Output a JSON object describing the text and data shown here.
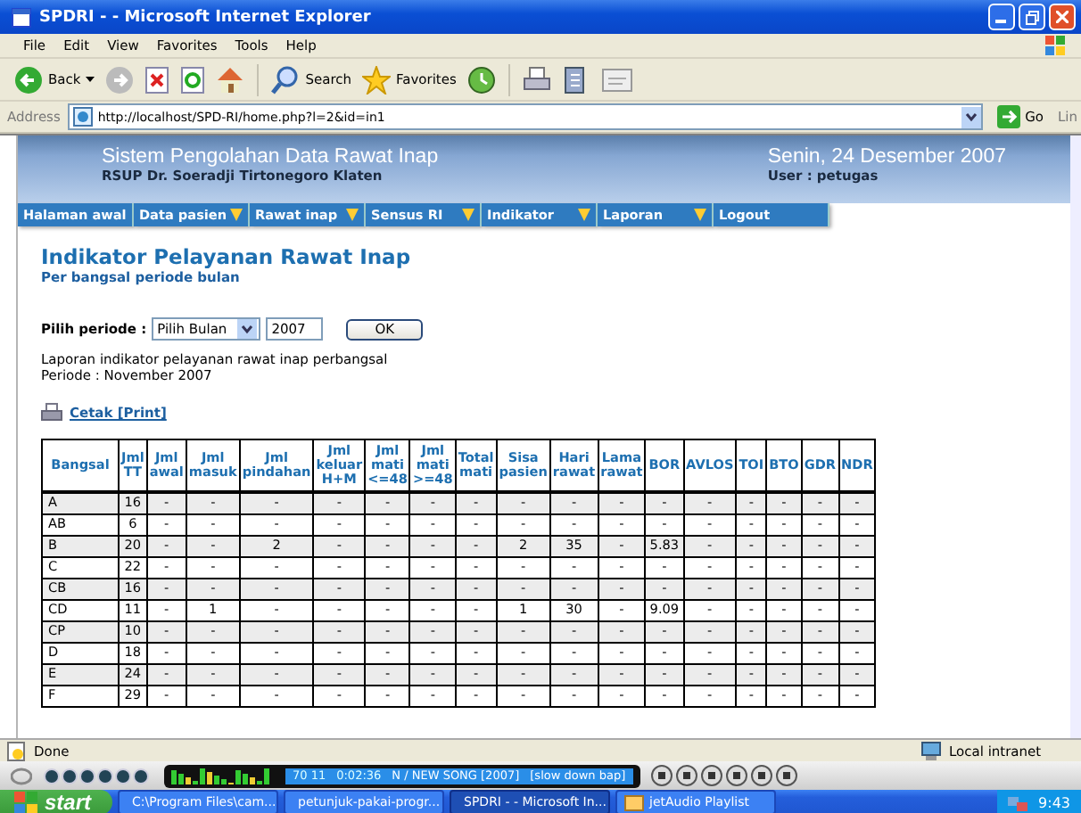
{
  "window": {
    "title": "SPDRI - - Microsoft Internet Explorer"
  },
  "menu_bar": [
    "File",
    "Edit",
    "View",
    "Favorites",
    "Tools",
    "Help"
  ],
  "toolbar": {
    "back": "Back",
    "search": "Search",
    "favorites": "Favorites"
  },
  "address_bar": {
    "label": "Address",
    "url": "http://localhost/SPD-RI/home.php?l=2&id=in1",
    "go": "Go",
    "links": "Lin"
  },
  "header": {
    "title": "Sistem Pengolahan Data Rawat Inap",
    "subtitle": "RSUP Dr. Soeradji Tirtonegoro Klaten",
    "date": "Senin, 24 Desember 2007",
    "user": "User : petugas"
  },
  "nav": [
    {
      "label": "Halaman awal",
      "has_submenu": false
    },
    {
      "label": "Data pasien",
      "has_submenu": true
    },
    {
      "label": "Rawat inap",
      "has_submenu": true
    },
    {
      "label": "Sensus RI",
      "has_submenu": true
    },
    {
      "label": "Indikator",
      "has_submenu": true
    },
    {
      "label": "Laporan",
      "has_submenu": true
    },
    {
      "label": "Logout",
      "has_submenu": false
    }
  ],
  "page": {
    "title": "Indikator Pelayanan Rawat Inap",
    "subtitle": "Per bangsal periode bulan",
    "period_label": "Pilih periode :",
    "month_select": "Pilih Bulan",
    "year": "2007",
    "ok": "OK",
    "report_line1": "Laporan indikator pelayanan rawat inap perbangsal",
    "report_line2": "Periode : November 2007",
    "print_link": "Cetak [Print]"
  },
  "table": {
    "columns": [
      "Bangsal",
      "Jml\nTT",
      "Jml\nawal",
      "Jml\nmasuk",
      "Jml\npindahan",
      "Jml\nkeluar\nH+M",
      "Jml\nmati\n<=48",
      "Jml\nmati\n>=48",
      "Total\nmati",
      "Sisa\npasien",
      "Hari\nrawat",
      "Lama\nrawat",
      "BOR",
      "AVLOS",
      "TOI",
      "BTO",
      "GDR",
      "NDR"
    ],
    "rows": [
      [
        "A",
        "16",
        "-",
        "-",
        "-",
        "-",
        "-",
        "-",
        "-",
        "-",
        "-",
        "-",
        "-",
        "-",
        "-",
        "-",
        "-",
        "-"
      ],
      [
        "AB",
        "6",
        "-",
        "-",
        "-",
        "-",
        "-",
        "-",
        "-",
        "-",
        "-",
        "-",
        "-",
        "-",
        "-",
        "-",
        "-",
        "-"
      ],
      [
        "B",
        "20",
        "-",
        "-",
        "2",
        "-",
        "-",
        "-",
        "-",
        "2",
        "35",
        "-",
        "5.83",
        "-",
        "-",
        "-",
        "-",
        "-"
      ],
      [
        "C",
        "22",
        "-",
        "-",
        "-",
        "-",
        "-",
        "-",
        "-",
        "-",
        "-",
        "-",
        "-",
        "-",
        "-",
        "-",
        "-",
        "-"
      ],
      [
        "CB",
        "16",
        "-",
        "-",
        "-",
        "-",
        "-",
        "-",
        "-",
        "-",
        "-",
        "-",
        "-",
        "-",
        "-",
        "-",
        "-",
        "-"
      ],
      [
        "CD",
        "11",
        "-",
        "1",
        "-",
        "-",
        "-",
        "-",
        "-",
        "1",
        "30",
        "-",
        "9.09",
        "-",
        "-",
        "-",
        "-",
        "-"
      ],
      [
        "CP",
        "10",
        "-",
        "-",
        "-",
        "-",
        "-",
        "-",
        "-",
        "-",
        "-",
        "-",
        "-",
        "-",
        "-",
        "-",
        "-",
        "-"
      ],
      [
        "D",
        "18",
        "-",
        "-",
        "-",
        "-",
        "-",
        "-",
        "-",
        "-",
        "-",
        "-",
        "-",
        "-",
        "-",
        "-",
        "-",
        "-"
      ],
      [
        "E",
        "24",
        "-",
        "-",
        "-",
        "-",
        "-",
        "-",
        "-",
        "-",
        "-",
        "-",
        "-",
        "-",
        "-",
        "-",
        "-",
        "-"
      ],
      [
        "F",
        "29",
        "-",
        "-",
        "-",
        "-",
        "-",
        "-",
        "-",
        "-",
        "-",
        "-",
        "-",
        "-",
        "-",
        "-",
        "-",
        "-"
      ]
    ]
  },
  "status_bar": {
    "text": "Done",
    "zone": "Local intranet"
  },
  "media_player": {
    "counter": "70 11",
    "time": "0:02:36",
    "song": "N / NEW SONG [2007]",
    "info": "[slow down bap]"
  },
  "taskbar": {
    "start": "start",
    "items": [
      {
        "label": "C:\\Program Files\\cam...",
        "selected": false
      },
      {
        "label": "petunjuk-pakai-progr...",
        "selected": false
      },
      {
        "label": "SPDRI - - Microsoft In...",
        "selected": true
      },
      {
        "label": "jetAudio Playlist",
        "selected": false
      }
    ],
    "clock": "9:43"
  }
}
